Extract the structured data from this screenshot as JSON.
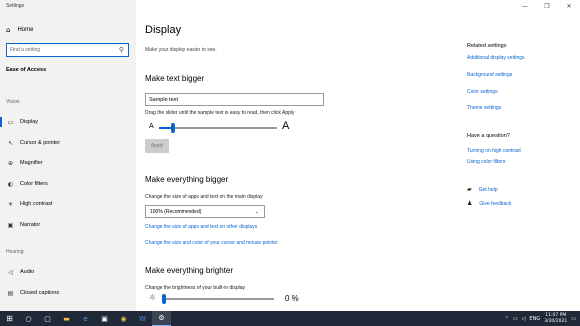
{
  "window": {
    "title": "Settings"
  },
  "sidebar": {
    "home_label": "Home",
    "search_placeholder": "Find a setting",
    "category": "Ease of Access",
    "sections": [
      {
        "label": "Vision",
        "items": [
          {
            "label": "Display",
            "icon": "display-icon",
            "active": true
          },
          {
            "label": "Cursor & pointer",
            "icon": "cursor-icon"
          },
          {
            "label": "Magnifier",
            "icon": "magnifier-icon"
          },
          {
            "label": "Color filters",
            "icon": "color-filters-icon"
          },
          {
            "label": "High contrast",
            "icon": "high-contrast-icon"
          },
          {
            "label": "Narrator",
            "icon": "narrator-icon"
          }
        ]
      },
      {
        "label": "Hearing",
        "items": [
          {
            "label": "Audio",
            "icon": "speaker-icon"
          },
          {
            "label": "Closed captions",
            "icon": "captions-icon"
          }
        ]
      }
    ]
  },
  "main": {
    "title": "Display",
    "subtitle": "Make your display easier to see.",
    "text_bigger": {
      "heading": "Make text bigger",
      "sample_value": "Sample text",
      "hint": "Drag the slider until the sample text is easy to read, then click Apply",
      "small_a": "A",
      "big_a": "A",
      "slider_value": 0.12,
      "apply_label": "Apply"
    },
    "everything_bigger": {
      "heading": "Make everything bigger",
      "label": "Change the size of apps and text on the main display",
      "dropdown_value": "100% (Recommended)",
      "link1": "Change the size of apps and text on other displays",
      "link2": "Change the size and color of your cursor and mouse pointer"
    },
    "everything_brighter": {
      "heading": "Make everything brighter",
      "label": "Change the brightness of your built-in display",
      "value_text": "0 %",
      "value": 0
    }
  },
  "right": {
    "related_heading": "Related settings",
    "related_links": [
      "Additional display settings",
      "Background settings",
      "Color settings",
      "Theme settings"
    ],
    "question_heading": "Have a question?",
    "question_links": [
      "Turning on high contrast",
      "Using color filters"
    ],
    "get_help": "Get help",
    "give_feedback": "Give feedback"
  },
  "taskbar": {
    "language": "ENG",
    "time": "11:07 PM",
    "date": "3/20/2021"
  },
  "colors": {
    "accent": "#0a64d0",
    "sidebar_bg": "#f2f2f2",
    "taskbar_bg": "#1f2937"
  }
}
